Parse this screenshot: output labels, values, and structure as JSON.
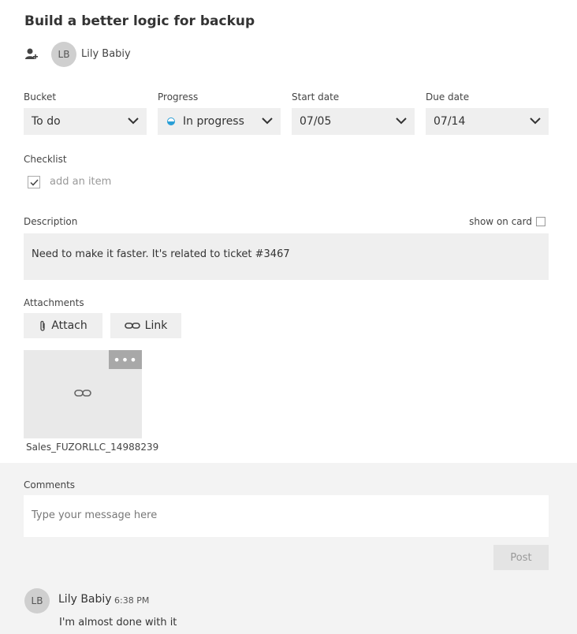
{
  "task": {
    "title": "Build a better logic for backup",
    "assignee": {
      "initials": "LB",
      "name": "Lily Babiy"
    }
  },
  "fields": {
    "bucket": {
      "label": "Bucket",
      "value": "To do"
    },
    "progress": {
      "label": "Progress",
      "value": "In progress"
    },
    "start_date": {
      "label": "Start date",
      "value": "07/05"
    },
    "due_date": {
      "label": "Due date",
      "value": "07/14"
    }
  },
  "checklist": {
    "label": "Checklist",
    "placeholder": "add an item"
  },
  "description": {
    "label": "Description",
    "show_on_card_label": "show on card",
    "text": "Need to make it faster. It's related to ticket #3467"
  },
  "attachments": {
    "label": "Attachments",
    "attach_label": "Attach",
    "link_label": "Link",
    "items": [
      {
        "name": "Sales_FUZORLLC_14988239"
      }
    ],
    "more_glyph": "•••"
  },
  "comments": {
    "label": "Comments",
    "placeholder": "Type your message here",
    "post_label": "Post",
    "items": [
      {
        "initials": "LB",
        "author": "Lily Babiy",
        "time": "6:38 PM",
        "text": "I'm almost done with it"
      }
    ]
  },
  "colors": {
    "progress_accent": "#2a9fd6",
    "field_bg": "#efefef",
    "comments_bg": "#f3f3f3"
  }
}
